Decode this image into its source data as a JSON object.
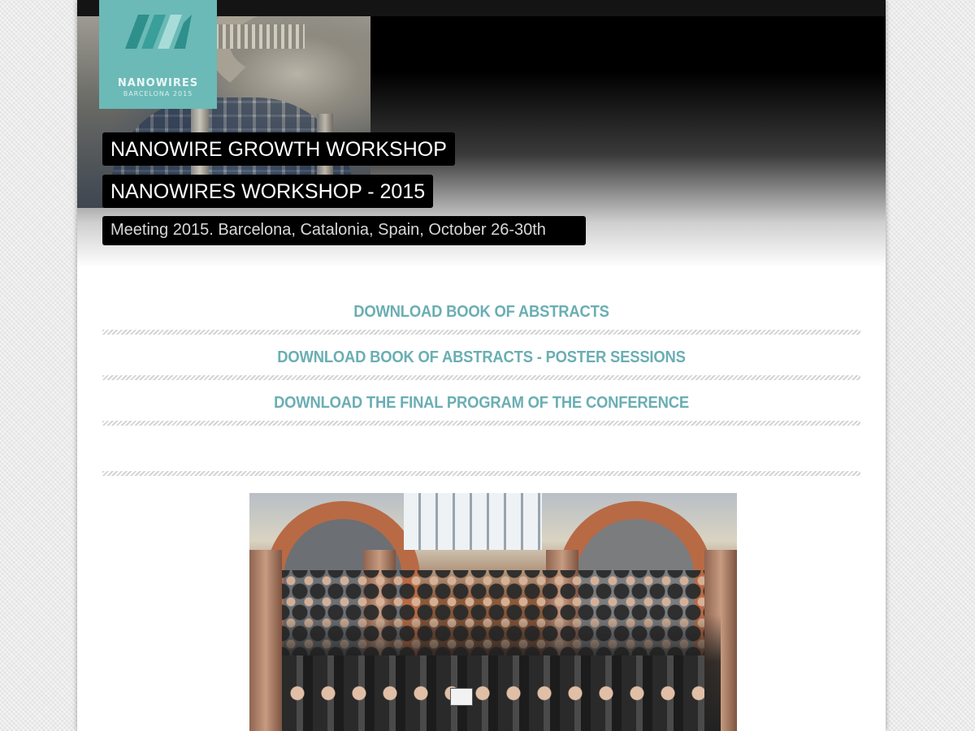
{
  "header": {
    "logo": {
      "name": "NANOWIRES",
      "subtitle": "BARCELONA 2015",
      "color": "#6bbab7"
    },
    "title1": "NANOWIRE GROWTH WORKSHOP",
    "title2": "NANOWIRES WORKSHOP - 2015",
    "subtitle": "Meeting 2015. Barcelona, Catalonia, Spain, October 26-30th"
  },
  "links": [
    {
      "label": "DOWNLOAD BOOK OF ABSTRACTS"
    },
    {
      "label": "DOWNLOAD BOOK OF ABSTRACTS - POSTER SESSIONS"
    },
    {
      "label": "DOWNLOAD THE FINAL PROGRAM OF THE CONFERENCE"
    }
  ],
  "colors": {
    "accent": "#6aaeb3",
    "title_bg": "#000000"
  }
}
